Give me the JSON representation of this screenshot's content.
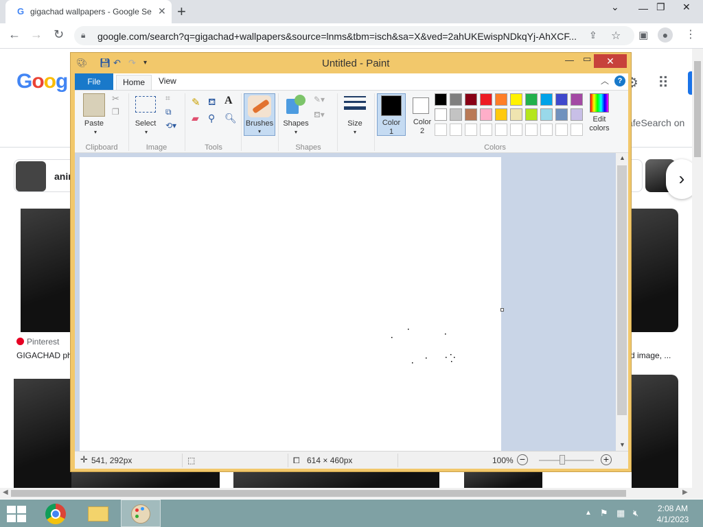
{
  "browser": {
    "tab_title": "gigachad wallpapers - Google Se",
    "tab_favicon": "G",
    "url": "google.com/search?q=gigachad+wallpapers&source=lnms&tbm=isch&sa=X&ved=2ahUKEwispNDkqYj-AhXCF..."
  },
  "google": {
    "logo": [
      "G",
      "o",
      "o",
      "g"
    ],
    "safesearch": "afeSearch on",
    "chip_label": "anir",
    "source": "Pinterest",
    "caption_left": "GIGACHAD ph",
    "caption_right": "d image, ..."
  },
  "paint": {
    "title": "Untitled - Paint",
    "tabs": {
      "file": "File",
      "home": "Home",
      "view": "View"
    },
    "buttons": {
      "paste": "Paste",
      "select": "Select",
      "brushes": "Brushes",
      "shapes": "Shapes",
      "size": "Size",
      "color1": "Color\n1",
      "color1_a": "Color",
      "color1_b": "1",
      "color2_a": "Color",
      "color2_b": "2",
      "edit_colors_a": "Edit",
      "edit_colors_b": "colors"
    },
    "groups": {
      "clipboard": "Clipboard",
      "image": "Image",
      "tools": "Tools",
      "shapes": "Shapes",
      "colors": "Colors"
    },
    "palette_row1": [
      "#000000",
      "#7f7f7f",
      "#880015",
      "#ed1c24",
      "#ff7f27",
      "#fff200",
      "#22b14c",
      "#00a2e8",
      "#3f48cc",
      "#a349a4"
    ],
    "palette_row2": [
      "#ffffff",
      "#c3c3c3",
      "#b97a57",
      "#ffaec9",
      "#ffc90e",
      "#efe4b0",
      "#b5e61d",
      "#99d9ea",
      "#7092be",
      "#c8bfe7"
    ],
    "color1_value": "#000000",
    "color2_value": "#ffffff",
    "status": {
      "cursor_pos": "541, 292px",
      "canvas_size": "614 × 460px",
      "zoom": "100%"
    }
  },
  "taskbar": {
    "time": "2:08 AM",
    "date": "4/1/2023"
  }
}
